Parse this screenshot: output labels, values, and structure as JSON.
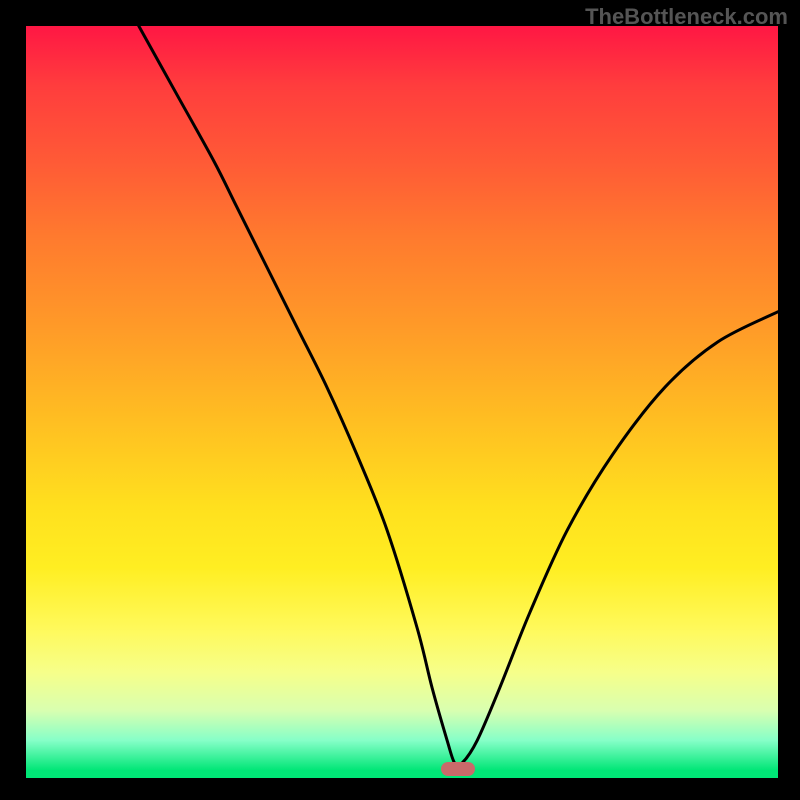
{
  "watermark": "TheBottleneck.com",
  "chart_data": {
    "type": "line",
    "title": "",
    "xlabel": "",
    "ylabel": "",
    "xlim": [
      0,
      100
    ],
    "ylim": [
      0,
      100
    ],
    "grid": false,
    "background_gradient": {
      "top": "#ff1744",
      "middle": "#ffe01e",
      "bottom": "#00e676"
    },
    "series": [
      {
        "name": "bottleneck-curve",
        "x": [
          15,
          20,
          25,
          28,
          32,
          36,
          40,
          44,
          48,
          52,
          54,
          56,
          57,
          58,
          60,
          63,
          67,
          72,
          78,
          85,
          92,
          100
        ],
        "y": [
          100,
          91,
          82,
          76,
          68,
          60,
          52,
          43,
          33,
          20,
          12,
          5,
          2,
          2,
          5,
          12,
          22,
          33,
          43,
          52,
          58,
          62
        ],
        "color": "#000000",
        "linewidth": 3
      }
    ],
    "marker": {
      "name": "optimal-point",
      "x": 57.5,
      "y": 1.2,
      "color": "#c96a6a"
    }
  }
}
